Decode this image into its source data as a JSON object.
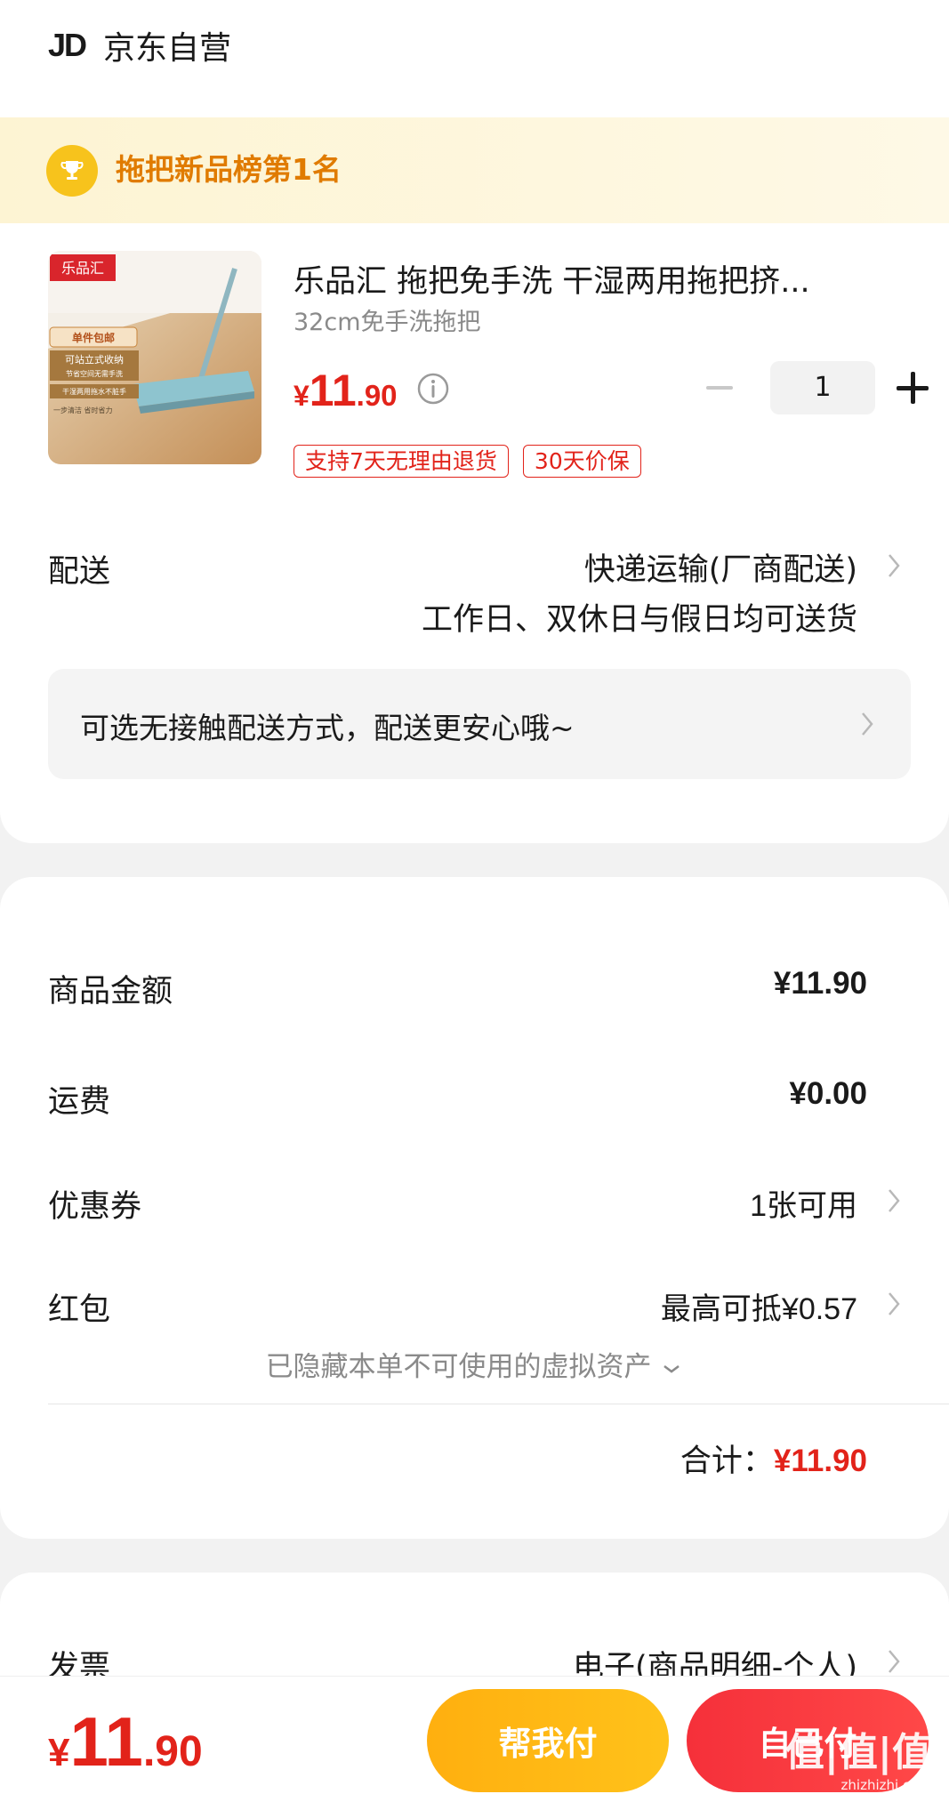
{
  "store": {
    "logo": "JD",
    "name": "京东自营"
  },
  "rank": {
    "text": "拖把新品榜第1名"
  },
  "product": {
    "title": "乐品汇 拖把免手洗 干湿两用拖把挤...",
    "spec": "32cm免手洗拖把",
    "price_currency": "¥",
    "price_int": "11",
    "price_dec": ".90",
    "quantity": "1",
    "tags": [
      "支持7天无理由退货",
      "30天价保"
    ],
    "image": {
      "brand": "乐品汇",
      "badge": "单件包邮",
      "line1": "可站立式收纳",
      "line2": "节省空间无需手洗",
      "line3": "干湿两用拖水不脏手",
      "line4": "一步清洁 省时省力"
    }
  },
  "shipping": {
    "label": "配送",
    "method": "快递运输(厂商配送)",
    "time": "工作日、双休日与假日均可送货",
    "notice": "可选无接触配送方式，配送更安心哦~"
  },
  "summary": {
    "goods_label": "商品金额",
    "goods_value": "¥11.90",
    "freight_label": "运费",
    "freight_value": "¥0.00",
    "coupon_label": "优惠券",
    "coupon_value": "1张可用",
    "redpacket_label": "红包",
    "redpacket_value": "最高可抵¥0.57",
    "hidden_assets": "已隐藏本单不可使用的虚拟资产",
    "total_label": "合计：",
    "total_value": "¥11.90"
  },
  "invoice": {
    "label": "发票",
    "value": "电子(商品明细-个人)"
  },
  "bottom": {
    "price_currency": "¥",
    "price_int": "11",
    "price_dec": ".90",
    "help_pay": "帮我付",
    "self_pay": "自己付"
  },
  "watermark": {
    "text": "值|值|值",
    "url": "zhizhizhi.com"
  },
  "colors": {
    "accent_red": "#e2231a",
    "gold": "#e07b00",
    "help_btn": "#ffb514"
  }
}
